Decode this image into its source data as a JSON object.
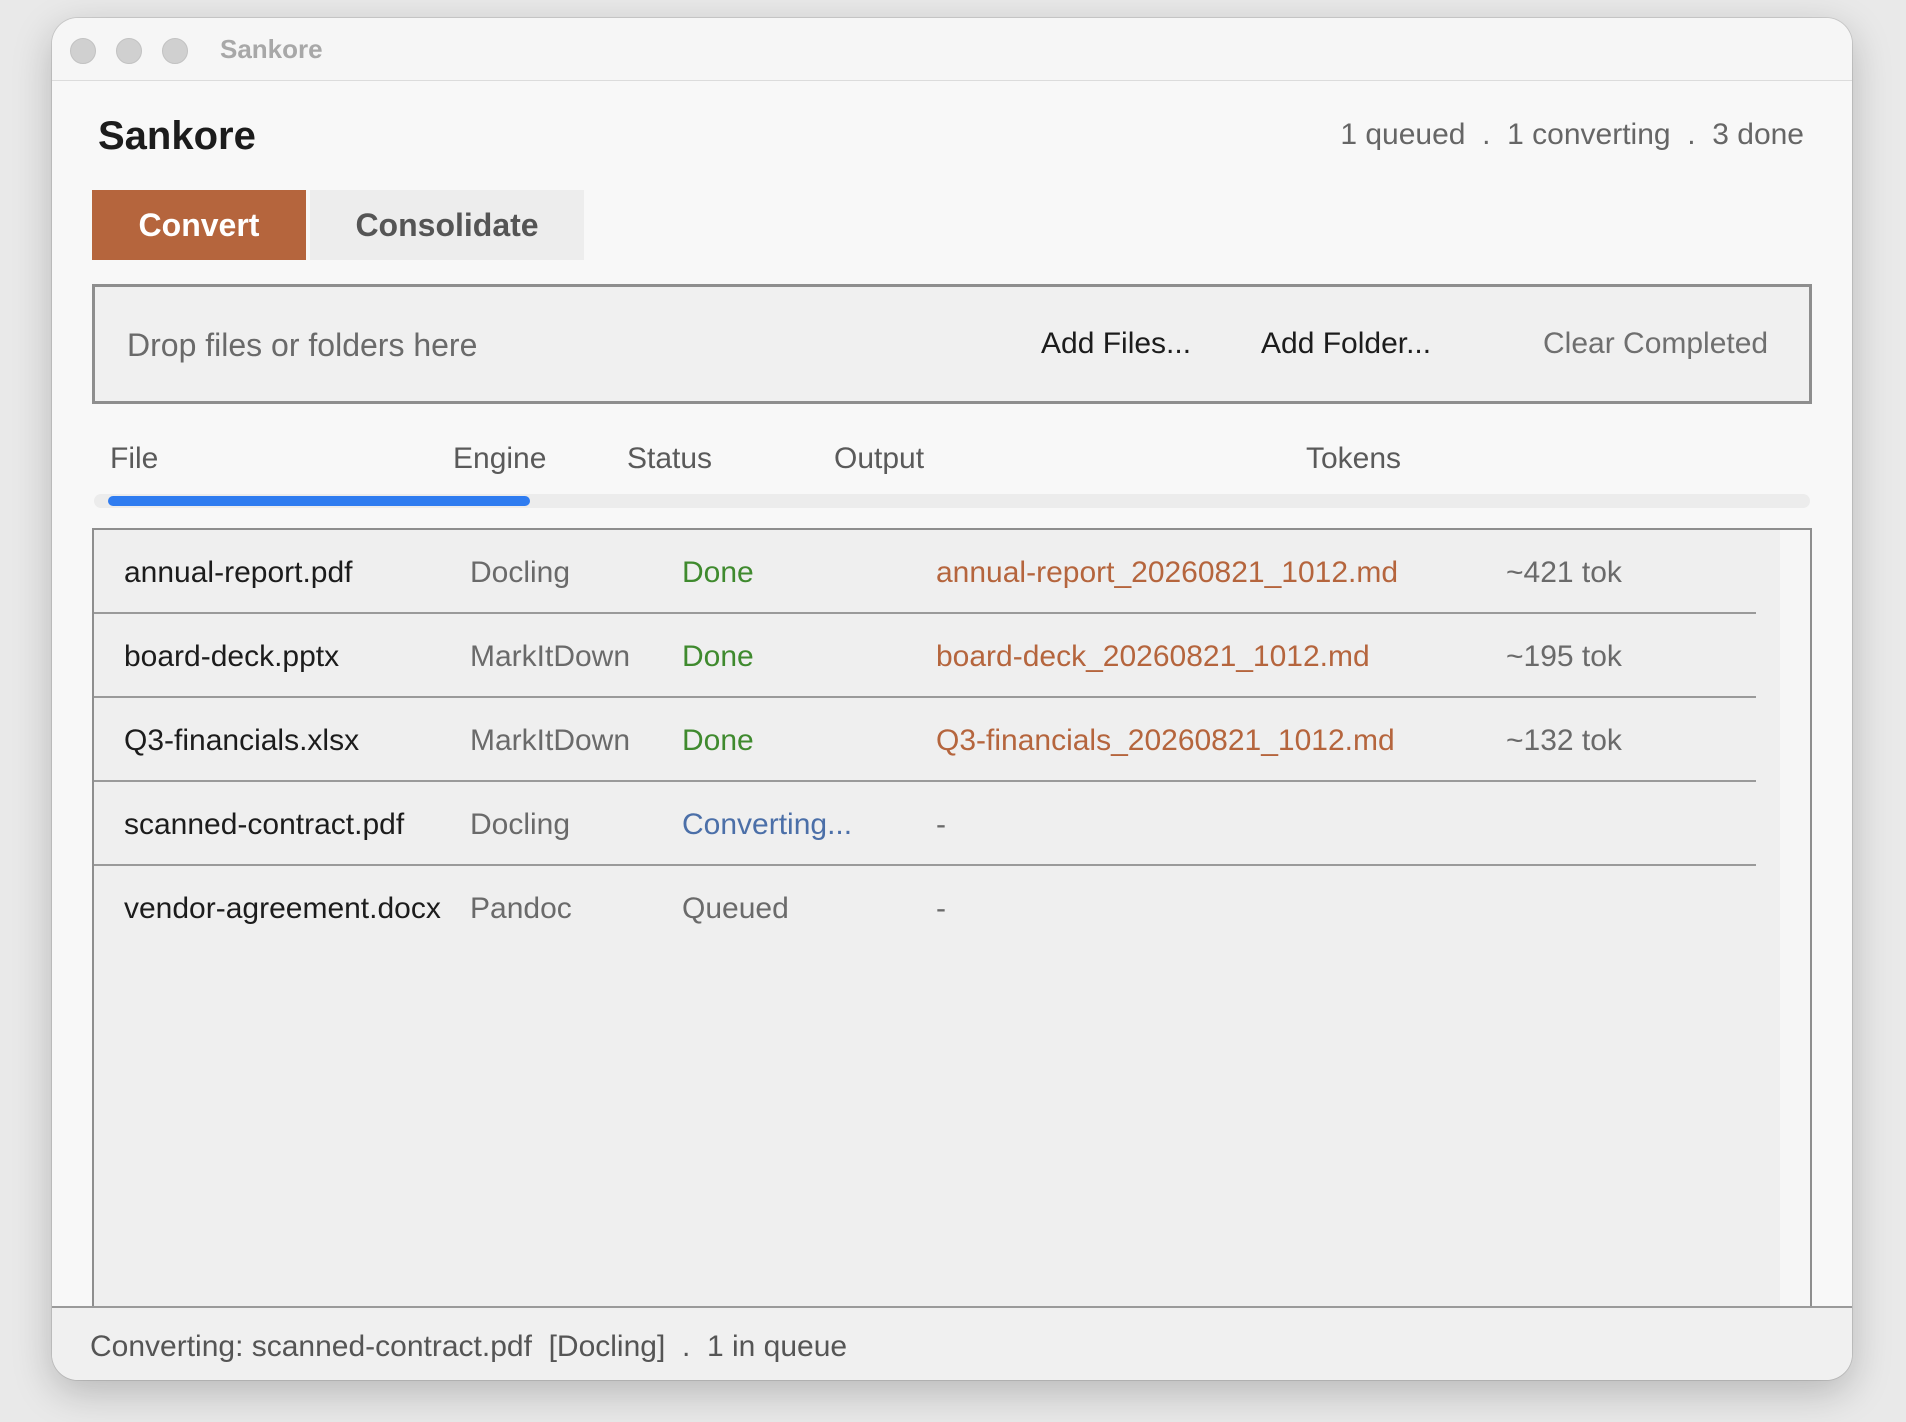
{
  "window": {
    "title": "Sankore"
  },
  "header": {
    "app_title": "Sankore",
    "summary": "1 queued  .  1 converting  .  3 done"
  },
  "tabs": [
    {
      "label": "Convert",
      "active": true
    },
    {
      "label": "Consolidate",
      "active": false
    }
  ],
  "dropzone": {
    "prompt": "Drop files or folders here",
    "add_files": "Add Files...",
    "add_folder": "Add Folder...",
    "clear_completed": "Clear Completed"
  },
  "columns": {
    "file": "File",
    "engine": "Engine",
    "status": "Status",
    "output": "Output",
    "tokens": "Tokens"
  },
  "progress": {
    "fraction": 0.25,
    "color": "#2f7cf0"
  },
  "rows": [
    {
      "file": "annual-report.pdf",
      "engine": "Docling",
      "status": "Done",
      "output": "annual-report_20260821_1012.md",
      "tokens": "~421 tok"
    },
    {
      "file": "board-deck.pptx",
      "engine": "MarkItDown",
      "status": "Done",
      "output": "board-deck_20260821_1012.md",
      "tokens": "~195 tok"
    },
    {
      "file": "Q3-financials.xlsx",
      "engine": "MarkItDown",
      "status": "Done",
      "output": "Q3-financials_20260821_1012.md",
      "tokens": "~132 tok"
    },
    {
      "file": "scanned-contract.pdf",
      "engine": "Docling",
      "status": "Converting...",
      "output": "-",
      "tokens": ""
    },
    {
      "file": "vendor-agreement.docx",
      "engine": "Pandoc",
      "status": "Queued",
      "output": "-",
      "tokens": ""
    }
  ],
  "statusbar": {
    "text": "Converting: scanned-contract.pdf  [Docling]  .  1 in queue"
  },
  "colors": {
    "accent": "#b5653d",
    "done": "#3f8a2e",
    "converting": "#4b6fa8",
    "link": "#b5653d"
  }
}
